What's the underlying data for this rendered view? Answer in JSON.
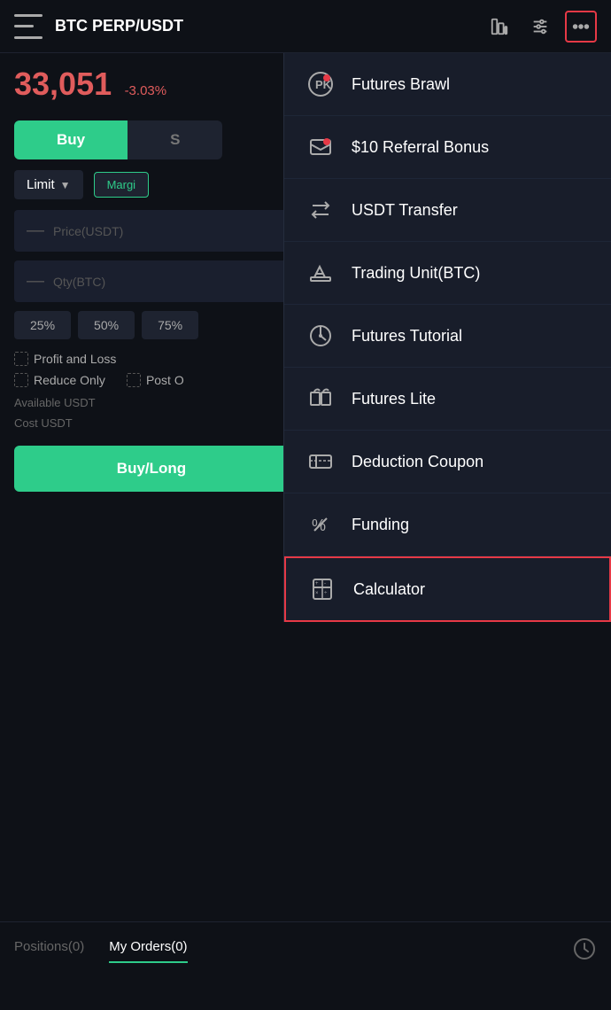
{
  "header": {
    "title": "BTC PERP/USDT",
    "menu_icon": "menu-icon",
    "chart_icon": "chart-icon",
    "settings_icon": "settings-icon",
    "more_icon": "more-icon"
  },
  "price": {
    "value": "33,051",
    "change": "-3.03%"
  },
  "trade": {
    "buy_label": "Buy",
    "sell_label": "S",
    "order_type": "Limit",
    "margin_label": "Margi",
    "price_placeholder": "Price(USDT)",
    "qty_placeholder": "Qty(BTC)",
    "percent_buttons": [
      "25%",
      "50%",
      "75%"
    ],
    "profit_loss_label": "Profit and Loss",
    "reduce_only_label": "Reduce Only",
    "post_only_label": "Post O",
    "available_label": "Available USDT",
    "cost_label": "Cost USDT",
    "buy_long_label": "Buy/Long"
  },
  "bottom_tabs": {
    "positions_label": "Positions(0)",
    "my_orders_label": "My Orders(0)"
  },
  "dropdown": {
    "items": [
      {
        "id": "futures-brawl",
        "label": "Futures Brawl",
        "has_dot": true
      },
      {
        "id": "referral-bonus",
        "label": "$10 Referral Bonus",
        "has_dot": true
      },
      {
        "id": "usdt-transfer",
        "label": "USDT Transfer",
        "has_dot": false
      },
      {
        "id": "trading-unit",
        "label": "Trading Unit(BTC)",
        "has_dot": false
      },
      {
        "id": "futures-tutorial",
        "label": "Futures Tutorial",
        "has_dot": false
      },
      {
        "id": "futures-lite",
        "label": "Futures Lite",
        "has_dot": false
      },
      {
        "id": "deduction-coupon",
        "label": "Deduction Coupon",
        "has_dot": false
      },
      {
        "id": "funding",
        "label": "Funding",
        "has_dot": false
      },
      {
        "id": "calculator",
        "label": "Calculator",
        "has_dot": false,
        "highlighted": true
      }
    ]
  }
}
